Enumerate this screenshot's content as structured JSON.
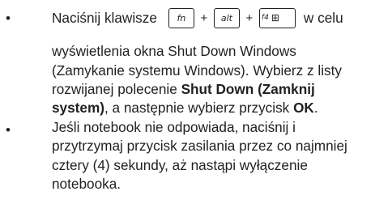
{
  "bullets": [
    "•",
    "•"
  ],
  "item1": {
    "lead": "Naciśnij klawisze",
    "keys": {
      "fn": "fn",
      "alt": "alt",
      "f4_label": "f4",
      "f4_icon": "⊞"
    },
    "plus": "+",
    "tail": "w celu",
    "line2": "wyświetlenia okna Shut Down Windows",
    "line3": "(Zamykanie systemu Windows). Wybierz z listy",
    "line4_pre": "rozwijanej polecenie ",
    "line4_bold": "Shut Down (Zamknij",
    "line5_bold": "system)",
    "line5_mid": ", a następnie wybierz przycisk ",
    "line5_bold2": "OK",
    "line5_end": "."
  },
  "item2": {
    "line1": "Jeśli notebook nie odpowiada, naciśnij i",
    "line2": "przytrzymaj przycisk zasilania przez co najmniej",
    "line3": "cztery (4) sekundy, aż nastąpi wyłączenie",
    "line4": "notebooka."
  }
}
